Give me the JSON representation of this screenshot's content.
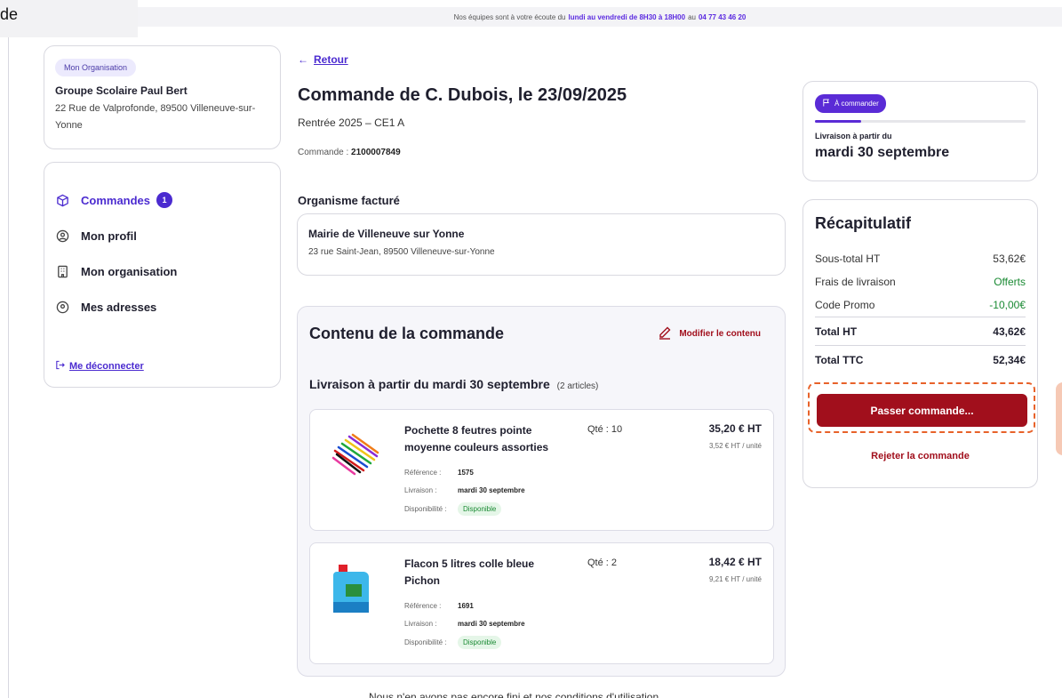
{
  "corner_text": "de",
  "topbar": {
    "prefix": "Nos équipes sont à votre écoute du",
    "hours": "lundi au vendredi de 8H30 à 18H00",
    "joiner": "au",
    "phone": "04 77 43 46 20"
  },
  "org": {
    "badge": "Mon Organisation",
    "name": "Groupe Scolaire Paul Bert",
    "address": "22 Rue de Valprofonde, 89500 Villeneuve-sur-Yonne"
  },
  "nav": {
    "items": [
      {
        "label": "Commandes",
        "icon": "package-icon",
        "badge": "1"
      },
      {
        "label": "Mon profil",
        "icon": "user-circle-icon"
      },
      {
        "label": "Mon organisation",
        "icon": "building-icon"
      },
      {
        "label": "Mes adresses",
        "icon": "location-pin-icon"
      }
    ],
    "logout": "Me déconnecter"
  },
  "back": {
    "arrow": "←",
    "label": "Retour"
  },
  "order": {
    "title": "Commande de C. Dubois, le 23/09/2025",
    "subtitle": "Rentrée 2025 – CE1 A",
    "number_label": "Commande :",
    "number": "2100007849"
  },
  "billing": {
    "title": "Organisme facturé",
    "name": "Mairie de Villeneuve sur Yonne",
    "address": "23 rue Saint-Jean, 89500 Villeneuve-sur-Yonne"
  },
  "content": {
    "title": "Contenu de la commande",
    "edit": "Modifier le contenu",
    "delivery_head": "Livraison à partir du mardi 30 septembre",
    "article_count": "(2 articles)",
    "items": [
      {
        "name": "Pochette 8 feutres pointe moyenne couleurs assorties",
        "qty": "Qté : 10",
        "price": "35,20 € HT",
        "unit": "3,52 € HT / unité",
        "ref_label": "Référence :",
        "ref": "1575",
        "deliv_label": "Livraison :",
        "deliv": "mardi 30 septembre",
        "dispo_label": "Disponibilité :",
        "dispo": "Disponible"
      },
      {
        "name": "Flacon 5 litres colle bleue Pichon",
        "qty": "Qté : 2",
        "price": "18,42 € HT",
        "unit": "9,21 € HT / unité",
        "ref_label": "Référence :",
        "ref": "1691",
        "deliv_label": "Livraison :",
        "deliv": "mardi 30 septembre",
        "dispo_label": "Disponibilité :",
        "dispo": "Disponible"
      }
    ]
  },
  "status": {
    "badge": "À commander",
    "progress": 0.22,
    "deliv_label": "Livraison à partir du",
    "deliv_date": "mardi 30 septembre"
  },
  "recap": {
    "title": "Récapitulatif",
    "rows": [
      {
        "label": "Sous-total HT",
        "value": "53,62€"
      },
      {
        "label": "Frais de livraison",
        "value": "Offerts"
      },
      {
        "label": "Code Promo",
        "value": "-10,00€"
      }
    ],
    "total_ht_label": "Total HT",
    "total_ht": "43,62€",
    "total_ttc_label": "Total TTC",
    "total_ttc": "52,34€",
    "order_button": "Passer commande...",
    "reject": "Rejeter la commande"
  },
  "footer_hint": "Nous n'en avons pas encore fini et nos conditions d'utilisation",
  "colors": {
    "primary": "#4b2bd0",
    "accent_red": "#a10f1c",
    "success": "#1a8a33",
    "highlight": "#e8622a"
  }
}
